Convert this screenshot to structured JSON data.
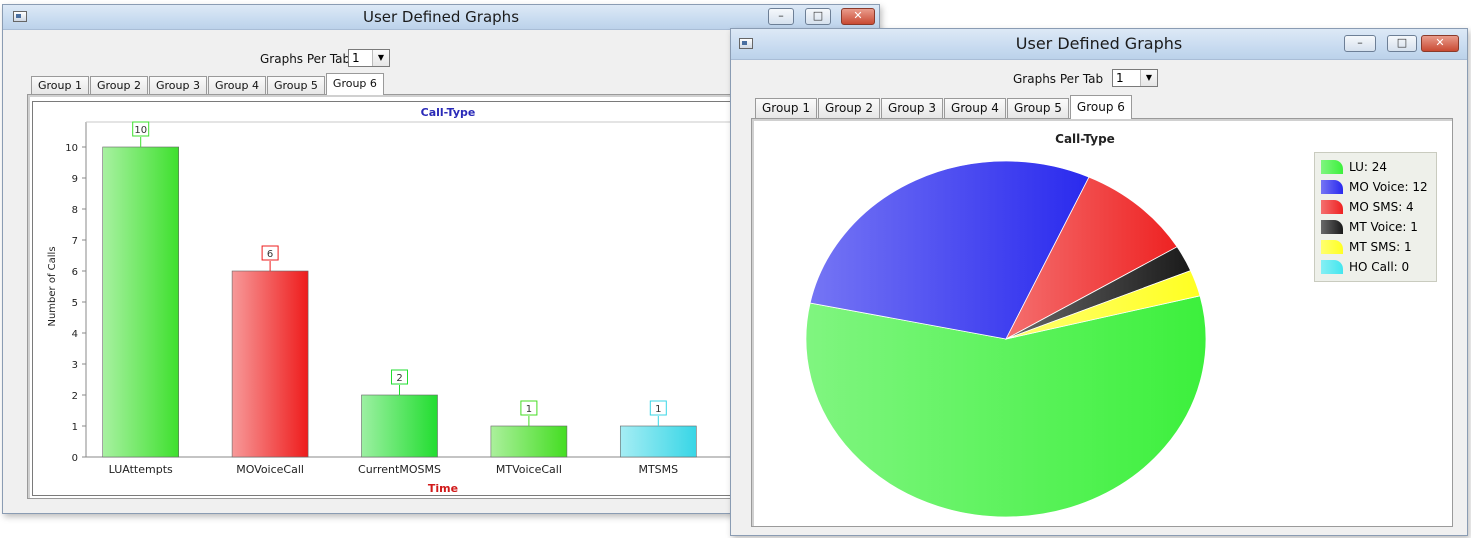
{
  "windows": [
    {
      "title": "User Defined Graphs",
      "graphs_per_tab_label": "Graphs Per Tab",
      "graphs_per_tab_value": "1",
      "tabs": [
        "Group 1",
        "Group 2",
        "Group 3",
        "Group 4",
        "Group 5",
        "Group 6"
      ],
      "active_tab": 5,
      "controls": {
        "minimize": "–",
        "maximize": "□",
        "close": "✕"
      }
    },
    {
      "title": "User Defined Graphs",
      "graphs_per_tab_label": "Graphs Per Tab",
      "graphs_per_tab_value": "1",
      "tabs": [
        "Group 1",
        "Group 2",
        "Group 3",
        "Group 4",
        "Group 5",
        "Group 6"
      ],
      "active_tab": 5,
      "controls": {
        "minimize": "–",
        "maximize": "□",
        "close": "✕"
      }
    }
  ],
  "chart_data": [
    {
      "type": "bar",
      "title": "Call-Type",
      "xlabel": "Time",
      "ylabel": "Number of Calls",
      "categories": [
        "LUAttempts",
        "MOVoiceCall",
        "CurrentMOSMS",
        "MTVoiceCall",
        "MTSMS"
      ],
      "values": [
        10,
        6,
        2,
        1,
        1
      ],
      "data_labels": [
        "10",
        "6",
        "2",
        "1",
        "1"
      ],
      "yticks": [
        "0",
        "1",
        "2",
        "3",
        "4",
        "5",
        "6",
        "7",
        "8",
        "9",
        "10"
      ],
      "ylim": [
        0,
        11
      ],
      "colors": [
        "#3ee02e",
        "#ee1c1c",
        "#22dd30",
        "#44dd22",
        "#38d6e6"
      ],
      "title_color": "#2a2ab8",
      "xlabel_color": "#d11a1a"
    },
    {
      "type": "pie",
      "title": "Call-Type",
      "categories": [
        "LU",
        "MO Voice",
        "MO SMS",
        "MT Voice",
        "MT SMS",
        "HO Call"
      ],
      "values": [
        24,
        12,
        4,
        1,
        1,
        0
      ],
      "legend_labels": [
        "LU: 24",
        "MO Voice: 12",
        "MO SMS: 4",
        "MT Voice: 1",
        "MT SMS: 1",
        "HO Call: 0"
      ],
      "colors": [
        "#3cf03c",
        "#2a2aee",
        "#ee2222",
        "#1a1a1a",
        "#ffff22",
        "#44e6ee"
      ],
      "legend": "top-right"
    }
  ]
}
